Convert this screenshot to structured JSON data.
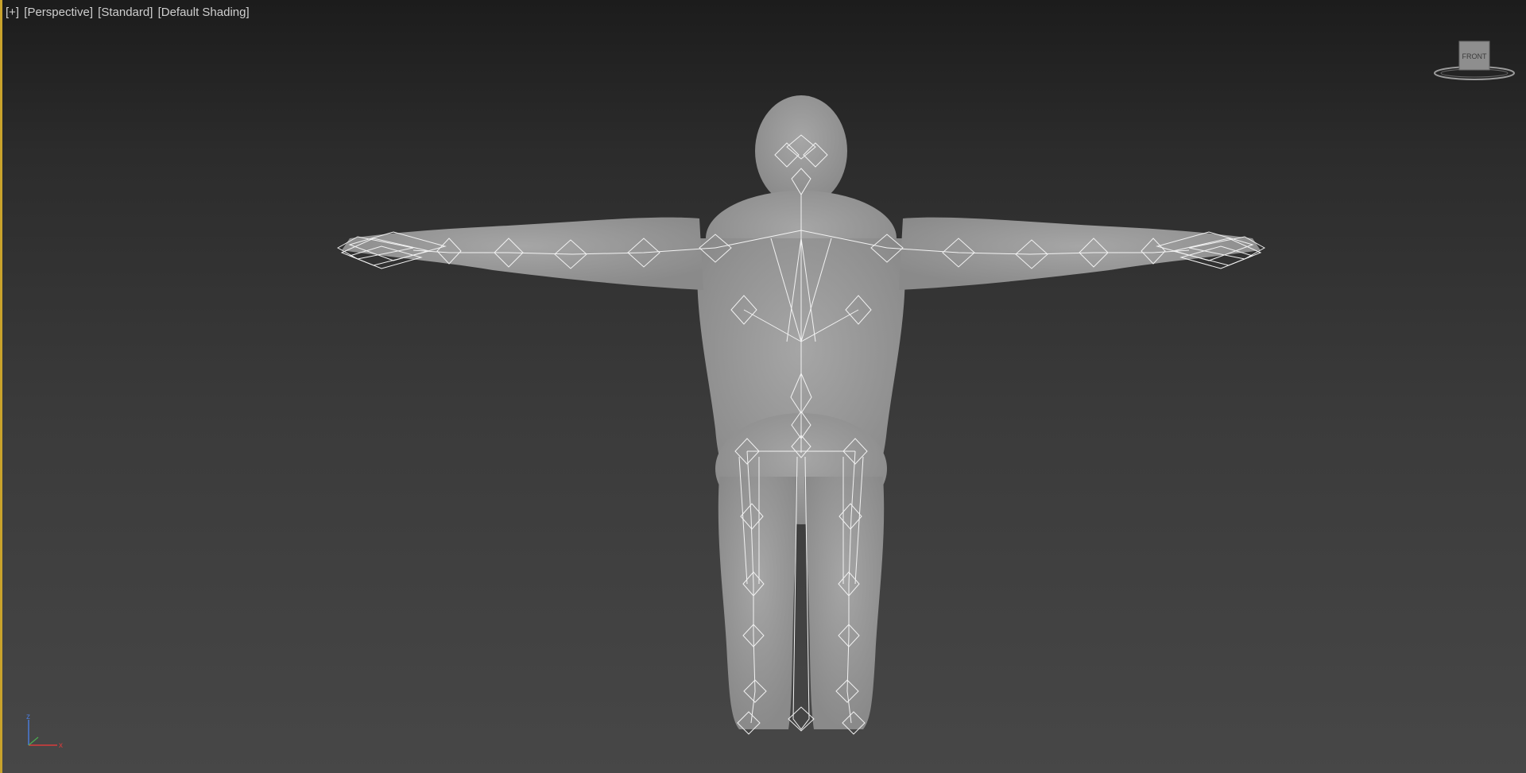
{
  "viewport": {
    "menus": {
      "plus": "[+]",
      "view": "[Perspective]",
      "render_mode": "[Standard]",
      "shading": "[Default Shading]"
    },
    "viewcube_face": "FRONT",
    "axis_labels": {
      "z": "z",
      "x": "x"
    }
  },
  "colors": {
    "active_viewport_border": "#c9a32c",
    "mesh": "#9a9a9a",
    "bones": "#f2f2f2",
    "axis_z": "#4a7bd8",
    "axis_x": "#d83c3c"
  },
  "icons": {
    "viewcube": "viewcube-icon",
    "axis_tripod": "axis-tripod-icon"
  }
}
